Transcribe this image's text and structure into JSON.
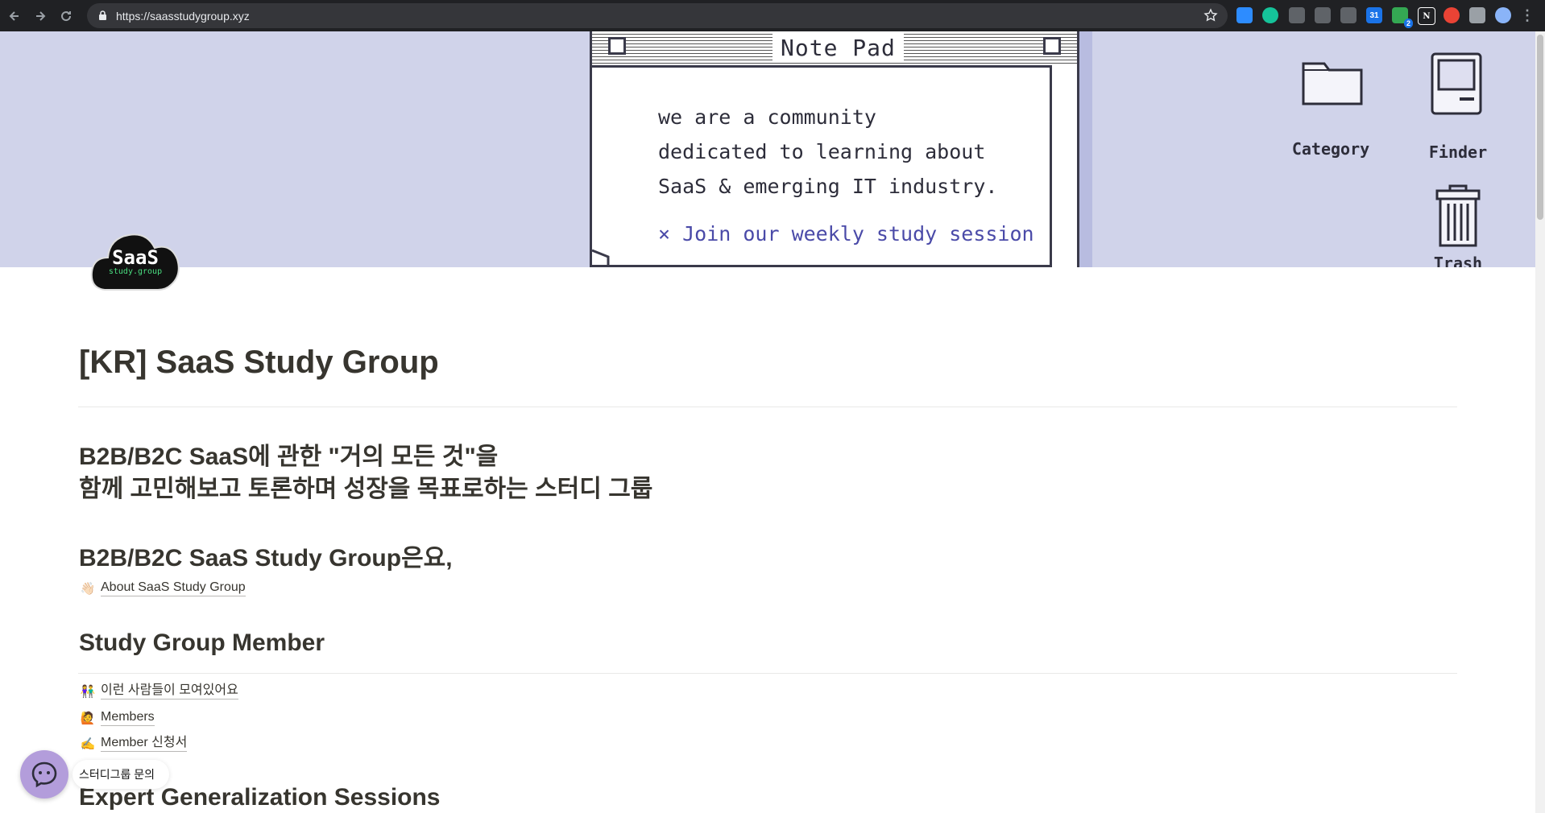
{
  "browser": {
    "url": "https://saasstudygroup.xyz",
    "extensions": [
      {
        "icon": "zoom-icon",
        "color": "#2d8cff"
      },
      {
        "icon": "grammarly-icon",
        "color": "#15c39a"
      },
      {
        "icon": "extension-c-icon",
        "color": "#5f6368"
      },
      {
        "icon": "extension-at-icon",
        "color": "#5f6368"
      },
      {
        "icon": "diamond-icon",
        "color": "#5f6368"
      },
      {
        "icon": "calendar-icon",
        "color": "#1a73e8",
        "text": "31"
      },
      {
        "icon": "extension-badge-icon",
        "color": "#34a853",
        "badge": "2"
      },
      {
        "icon": "notion-icon",
        "color": "#ffffff",
        "text": "N"
      },
      {
        "icon": "block-icon",
        "color": "#ea4335"
      },
      {
        "icon": "puzzle-icon",
        "color": "#9aa0a6"
      },
      {
        "icon": "profile-avatar-icon",
        "color": "#8ab4f8"
      }
    ]
  },
  "cover": {
    "notepad_title": "Note Pad",
    "lines": [
      "we are a community",
      "dedicated to learning about",
      "SaaS & emerging IT industry."
    ],
    "link_text": "× Join our weekly study session",
    "desktop_icons": [
      {
        "label": "Category",
        "icon": "folder-icon"
      },
      {
        "label": "Finder",
        "icon": "mac-computer-icon"
      },
      {
        "label": "Trash",
        "icon": "trash-icon"
      }
    ],
    "bg_color": "#d0d3ea"
  },
  "page_icon": {
    "main": "SaaS",
    "sub": "study.group"
  },
  "page": {
    "title": "[KR] SaaS Study Group",
    "subtitle_line1": "B2B/B2C SaaS에 관한 \"거의 모든 것\"을",
    "subtitle_line2": "함께 고민해보고 토론하며 성장을 목표로하는 스터디 그룹",
    "about_heading": "B2B/B2C SaaS Study Group은요,",
    "about_link": {
      "emoji": "👋🏻",
      "label": "About SaaS Study Group"
    },
    "member_heading": "Study Group Member",
    "member_links": [
      {
        "emoji": "👫",
        "label": "이런 사람들이 모여있어요"
      },
      {
        "emoji": "🙋",
        "label": "Members"
      },
      {
        "emoji": "✍️",
        "label": "Member 신청서"
      }
    ],
    "expert_heading": "Expert Generalization Sessions"
  },
  "chat": {
    "label": "스터디그룹 문의",
    "color": "#b39ddb"
  }
}
